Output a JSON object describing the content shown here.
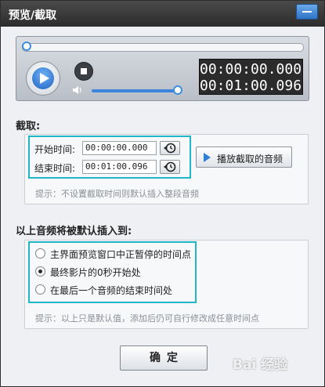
{
  "window": {
    "title": "预览/截取"
  },
  "player": {
    "elapsed_time": "00:00:00.000",
    "total_time": "00:01:00.096",
    "seek_position": 0.0,
    "volume_level": 0.95
  },
  "trim": {
    "section_label": "截取:",
    "start_label": "开始时间:",
    "start_value": "00:00:00.000",
    "end_label": "结束时间:",
    "end_value": "00:01:00.096",
    "play_button_label": "播放截取的音频",
    "hint": "提示：不设置截取时间则默认插入整段音频"
  },
  "insert": {
    "section_label": "以上音频将被默认插入到:",
    "options": [
      {
        "label": "主界面预览窗口中正暂停的时间点",
        "checked": false
      },
      {
        "label": "最终影片的0秒开始处",
        "checked": true
      },
      {
        "label": "在最后一个音频的结束时间处",
        "checked": false
      }
    ],
    "hint": "提示：以上只是默认值，添加后仍可自行修改成任意时间点"
  },
  "ok_button_label": "确定",
  "watermark": "Bai 经验",
  "colors": {
    "accent": "#1fb6c8",
    "title_bar": "#333333",
    "play_blue": "#2f7fd8"
  }
}
